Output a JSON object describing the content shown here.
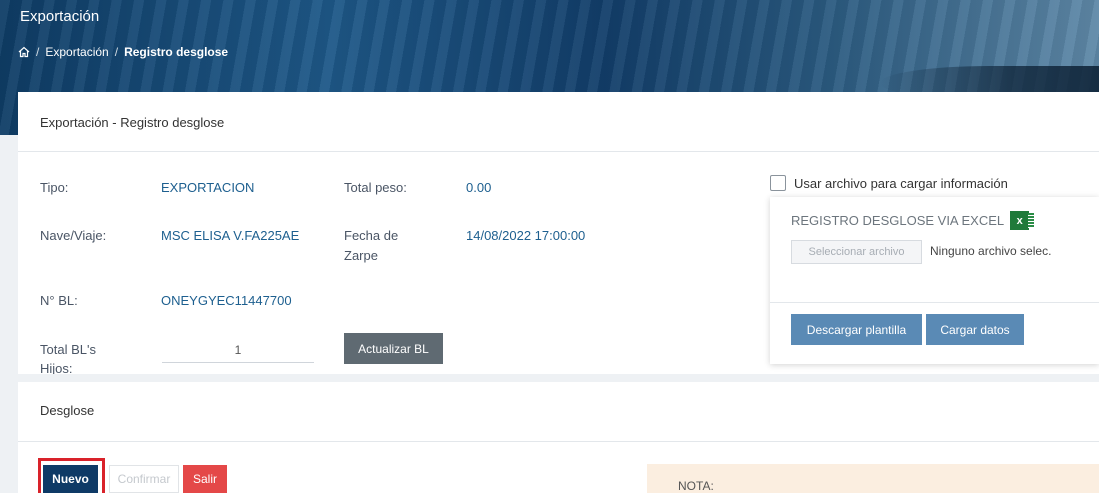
{
  "header": {
    "title": "Exportación",
    "breadcrumb": {
      "home_icon": "home-icon",
      "items": [
        "Exportación",
        "Registro desglose"
      ]
    }
  },
  "card": {
    "title": "Exportación - Registro desglose",
    "fields": {
      "tipo_label": "Tipo:",
      "tipo_value": "EXPORTACION",
      "total_peso_label": "Total peso:",
      "total_peso_value": "0.00",
      "nave_label": "Nave/Viaje:",
      "nave_value": "MSC ELISA V.FA225AE",
      "fecha_label_1": "Fecha de",
      "fecha_label_2": "Zarpe",
      "fecha_value": "14/08/2022 17:00:00",
      "bl_label": "N° BL:",
      "bl_value": "ONEYGYEC11447700",
      "total_hijos_label_1": "Total BL's",
      "total_hijos_label_2": "Hijos:",
      "total_hijos_value": "1"
    },
    "actualizar_button": "Actualizar BL"
  },
  "excel": {
    "checkbox_label": "Usar archivo para cargar información",
    "checkbox_checked": false,
    "title": "REGISTRO DESGLOSE VIA EXCEL",
    "icon": "excel-icon",
    "icon_letter": "x",
    "select_button": "Seleccionar archivo",
    "file_status": "Ninguno archivo selec.",
    "descargar_button": "Descargar plantilla",
    "cargar_button": "Cargar datos"
  },
  "desglose": {
    "title": "Desglose",
    "nuevo_button": "Nuevo",
    "confirmar_button": "Confirmar",
    "salir_button": "Salir",
    "nota_label": "NOTA:"
  }
}
